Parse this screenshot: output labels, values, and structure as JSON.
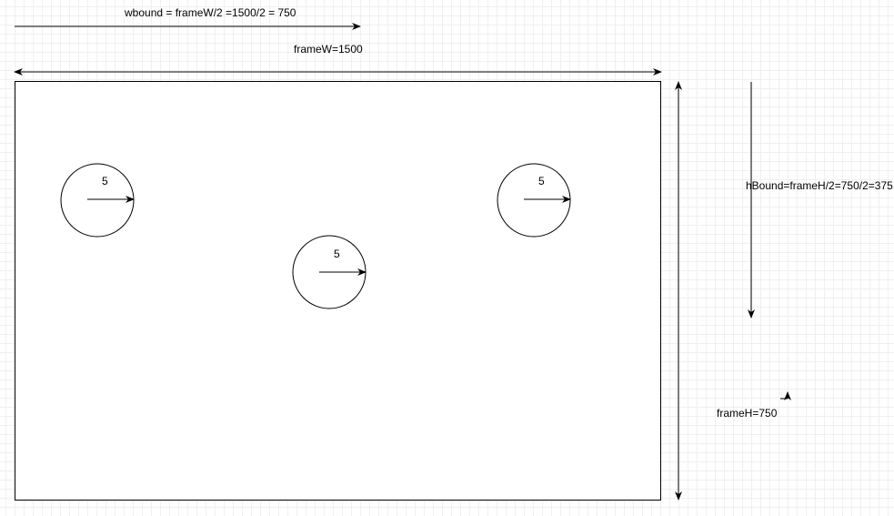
{
  "labels": {
    "wbound": "wbound = frameW/2 =1500/2 = 750",
    "frame_w": "frameW=1500",
    "hbound": "hBound=frameH/2=750/2=375",
    "frame_h": "frameH=750",
    "circle_left_radius": "5",
    "circle_middle_radius": "5",
    "circle_right_radius": "5"
  },
  "colors": {
    "stroke": "#000000",
    "background": "#ffffff",
    "grid": "#e6e6e6"
  }
}
